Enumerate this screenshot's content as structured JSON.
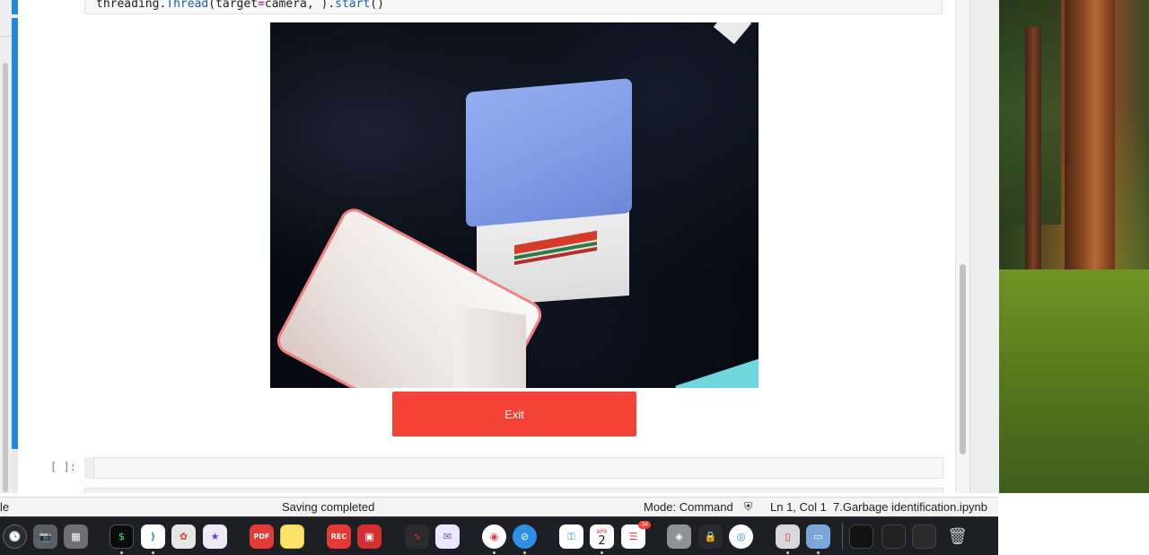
{
  "code": {
    "fragment_plain": "threading.",
    "fragment_class": "Thread",
    "fragment_args_open": "(target",
    "fragment_eq": "=",
    "fragment_args_mid": "camera, ).",
    "fragment_call": "start",
    "fragment_end": "()"
  },
  "widget": {
    "exit_label": "Exit"
  },
  "next_cell": {
    "prompt": "[ ]:"
  },
  "status_bar": {
    "left_fragment": "le",
    "saving": "Saving completed",
    "mode": "Mode: Command",
    "position": "Ln 1, Col 1",
    "filename": "7.Garbage identification.ipynb"
  },
  "dock": {
    "calendar_month": "APR",
    "calendar_day": "2",
    "reminders_badge": "34"
  },
  "colors": {
    "exit_button": "#f44336",
    "cell_indicator": "#1e88e5"
  }
}
